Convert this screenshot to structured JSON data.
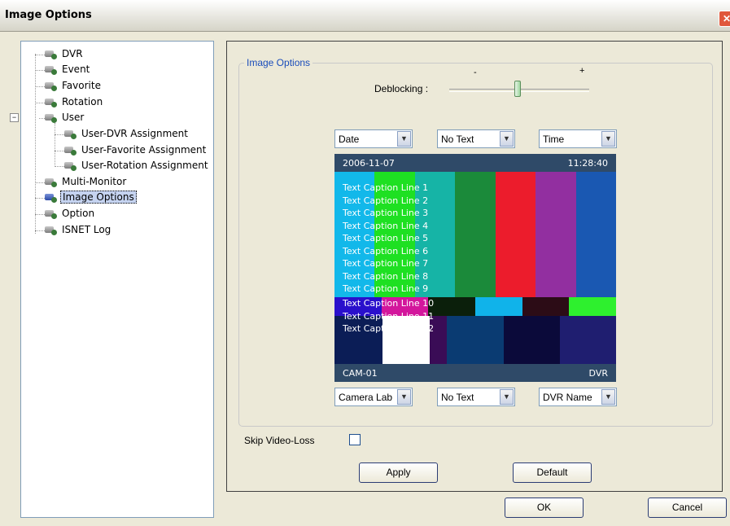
{
  "window": {
    "title": "Image Options",
    "close_glyph": "✕"
  },
  "tree": {
    "collapse_glyph": "−",
    "items": [
      {
        "label": "DVR",
        "icon": "dvr-icon"
      },
      {
        "label": "Event",
        "icon": "event-icon"
      },
      {
        "label": "Favorite",
        "icon": "favorite-icon"
      },
      {
        "label": "Rotation",
        "icon": "rotation-icon"
      },
      {
        "label": "User",
        "icon": "user-icon"
      },
      {
        "label": "User-DVR Assignment",
        "icon": "user-dvr-assignment-icon"
      },
      {
        "label": "User-Favorite Assignment",
        "icon": "user-favorite-assignment-icon"
      },
      {
        "label": "User-Rotation Assignment",
        "icon": "user-rotation-assignment-icon"
      },
      {
        "label": "Multi-Monitor",
        "icon": "multi-monitor-icon"
      },
      {
        "label": "Image Options",
        "icon": "image-options-icon",
        "selected": true
      },
      {
        "label": "Option",
        "icon": "option-icon"
      },
      {
        "label": "ISNET Log",
        "icon": "isnet-log-icon"
      }
    ]
  },
  "group": {
    "title": "Image Options",
    "deblocking_label": "Deblocking :",
    "slider_min": "-",
    "slider_max": "+",
    "deblocking_level": 0.49
  },
  "combos": {
    "top_left": "Date",
    "top_center": "No Text",
    "top_right": "Time",
    "bottom_left": "Camera Lab",
    "bottom_center": "No Text",
    "bottom_right": "DVR Name",
    "arrow_glyph": "▼"
  },
  "preview": {
    "date": "2006-11-07",
    "time": "11:28:40",
    "camera": "CAM-01",
    "dvr": "DVR",
    "captions": [
      "Text Caption Line 1",
      "Text Caption Line 2",
      "Text Caption Line 3",
      "Text Caption Line 4",
      "Text Caption Line 5",
      "Text Caption Line 6",
      "Text Caption Line 7",
      "Text Caption Line 8",
      "Text Caption Line 9",
      "Text Caption Line 10",
      "Text Caption Line 11",
      "Text Caption Line 12"
    ],
    "colors": {
      "bars": [
        "#12b8ea",
        "#1ee022",
        "#16b4a6",
        "#1b8a3a",
        "#ec1c2c",
        "#922fa0",
        "#1a58b2"
      ],
      "mid": [
        "#2a10cc",
        "#d3169c",
        "#0b1f0b",
        "#10b3ea",
        "#2c0c16",
        "#2ef02e"
      ],
      "low": [
        "#0b1d56",
        "#3a0c56",
        "#0a3b72",
        "#0b0a3a",
        "#1f1e70"
      ]
    }
  },
  "skip_label": "Skip Video-Loss",
  "buttons": {
    "apply": "Apply",
    "default": "Default",
    "ok": "OK",
    "cancel": "Cancel"
  }
}
